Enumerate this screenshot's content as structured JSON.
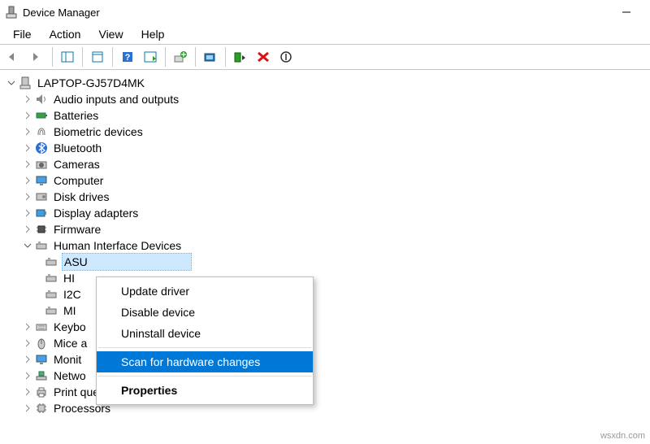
{
  "window": {
    "title": "Device Manager"
  },
  "menubar": {
    "file": "File",
    "action": "Action",
    "view": "View",
    "help": "Help"
  },
  "tree": {
    "root": "LAPTOP-GJ57D4MK",
    "categories": [
      {
        "label": "Audio inputs and outputs",
        "expanded": false
      },
      {
        "label": "Batteries",
        "expanded": false
      },
      {
        "label": "Biometric devices",
        "expanded": false
      },
      {
        "label": "Bluetooth",
        "expanded": false
      },
      {
        "label": "Cameras",
        "expanded": false
      },
      {
        "label": "Computer",
        "expanded": false
      },
      {
        "label": "Disk drives",
        "expanded": false
      },
      {
        "label": "Display adapters",
        "expanded": false
      },
      {
        "label": "Firmware",
        "expanded": false
      }
    ],
    "hid": {
      "label": "Human Interface Devices",
      "children": [
        {
          "label": "ASU"
        },
        {
          "label": "HI"
        },
        {
          "label": "I2C"
        },
        {
          "label": "MI"
        }
      ]
    },
    "after": [
      {
        "label": "Keybo"
      },
      {
        "label": "Mice a"
      },
      {
        "label": "Monit"
      },
      {
        "label": "Netwo"
      },
      {
        "label": "Print queues"
      },
      {
        "label": "Processors"
      }
    ]
  },
  "context_menu": {
    "update": "Update driver",
    "disable": "Disable device",
    "uninstall": "Uninstall device",
    "scan": "Scan for hardware changes",
    "properties": "Properties"
  },
  "watermark": "wsxdn.com"
}
